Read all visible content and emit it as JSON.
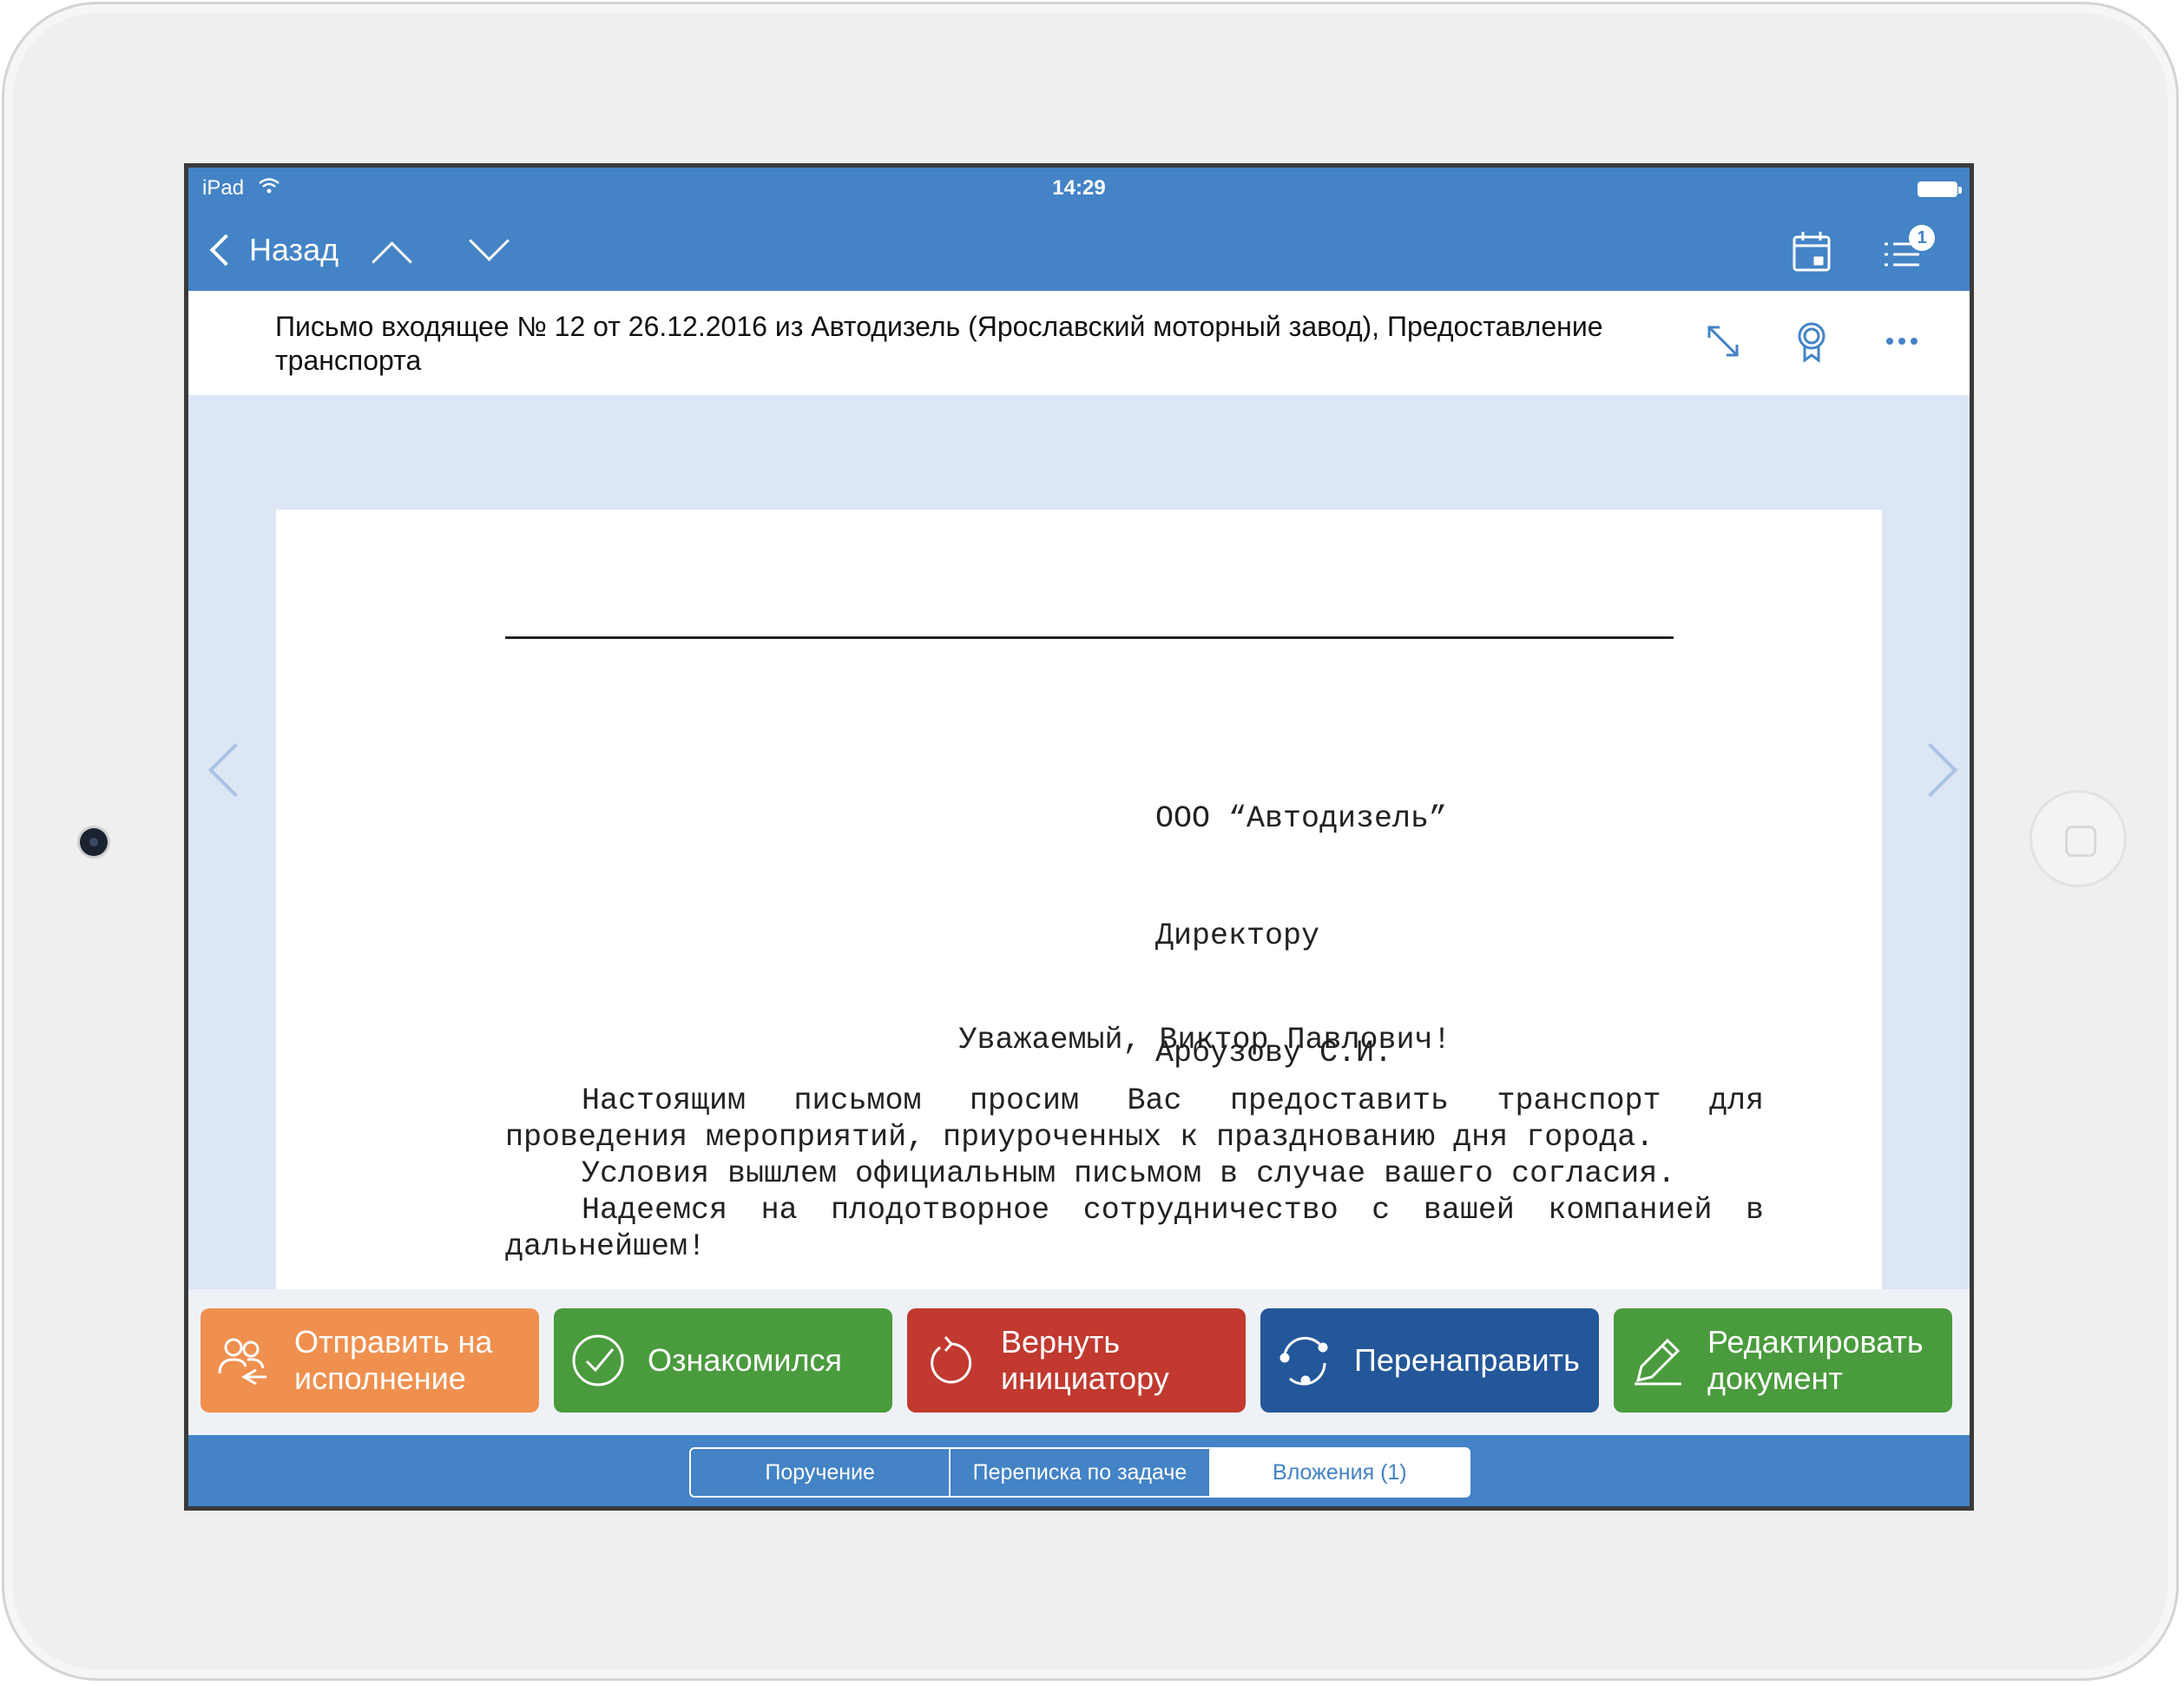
{
  "status_bar": {
    "carrier": "iPad",
    "time": "14:29"
  },
  "nav": {
    "back_label": "Назад",
    "tasks_badge": "1"
  },
  "document": {
    "title": "Письмо входящее № 12 от 26.12.2016 из Автодизель (Ярославский моторный завод),  Предоставление транспорта"
  },
  "letter": {
    "addressee": [
      "ООО “Автодизель”",
      "Директору",
      "Арбузову С.И."
    ],
    "greeting": "Уважаемый, Виктор Павлович!",
    "paragraphs": [
      "Настоящим письмом просим Вас предоставить транспорт для проведения мероприятий, приуроченных к празднованию дня города.",
      "Условия вышлем официальным письмом в случае вашего согласия.",
      "Надеемся на плодотворное сотрудничество с вашей компанией в дальнейшем!"
    ]
  },
  "actions": [
    {
      "label": "Отправить на исполнение",
      "color": "#f0904f",
      "icon": "users-send-icon"
    },
    {
      "label": "Ознакомился",
      "color": "#4a9b3d",
      "icon": "check-circle-icon"
    },
    {
      "label": "Вернуть инициатору",
      "color": "#c1392f",
      "icon": "undo-icon"
    },
    {
      "label": "Перенаправить",
      "color": "#23579a",
      "icon": "redirect-icon"
    },
    {
      "label": "Редактировать документ",
      "color": "#4a9b3d",
      "icon": "pencil-icon"
    }
  ],
  "tabs": [
    {
      "label": "Поручение"
    },
    {
      "label": "Переписка по задаче"
    },
    {
      "label": "Вложения (1)",
      "selected": true
    }
  ],
  "colors": {
    "header_blue": "#4383c6",
    "viewer_bg": "#dce6f5"
  }
}
